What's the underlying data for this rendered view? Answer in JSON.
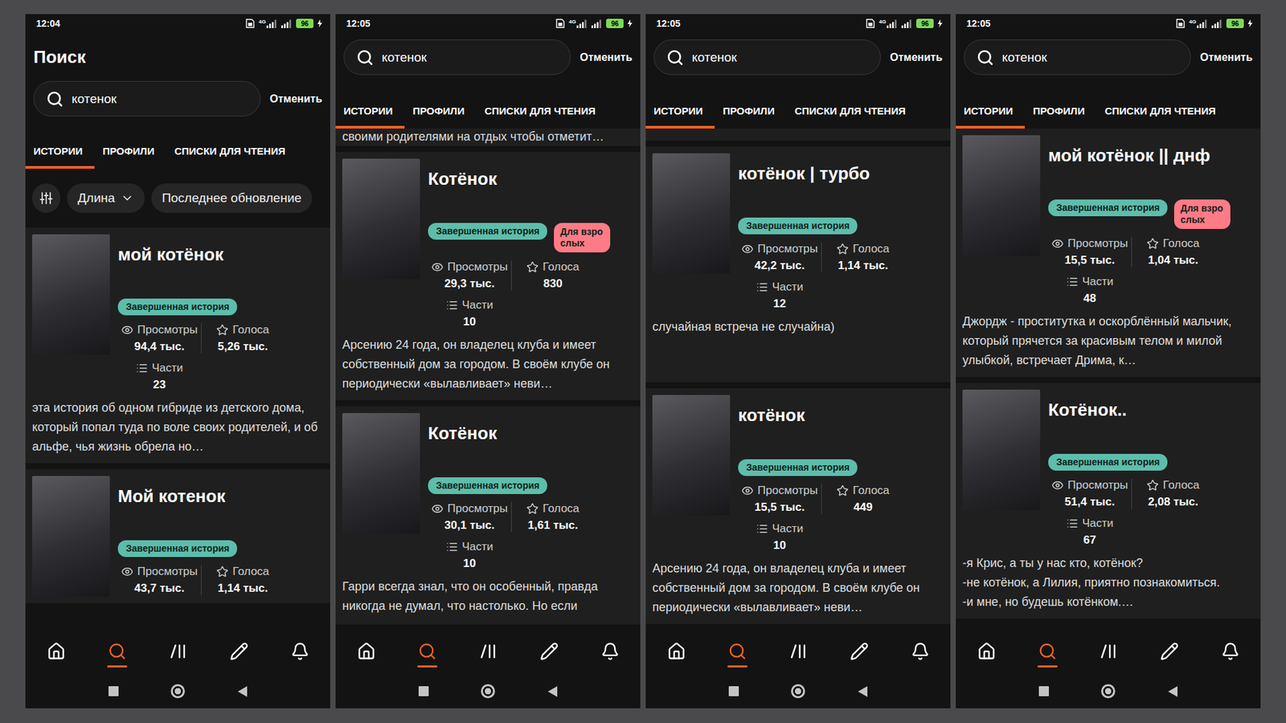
{
  "phones": [
    {
      "status_bar": {
        "time": "12:04",
        "network": "4G",
        "battery": "96"
      },
      "header_title": "Поиск",
      "search": {
        "value": "котенок",
        "cancel": "Отменить"
      },
      "tabs": [
        {
          "label": "ИСТОРИИ",
          "selected": true
        },
        {
          "label": "ПРОФИЛИ",
          "selected": false
        },
        {
          "label": "СПИСКИ ДЛЯ ЧТЕНИЯ",
          "selected": false
        }
      ],
      "filters": [
        {
          "kind": "icon"
        },
        {
          "kind": "dropdown",
          "label": "Длина"
        },
        {
          "kind": "chip",
          "label": "Последнее обновление"
        }
      ],
      "stories": [
        {
          "title": "мой котёнок",
          "badges": [
            {
              "label": "Завершенная история",
              "kind": "complete",
              "color": "#5dbdaa"
            }
          ],
          "stats": [
            {
              "kind": "views",
              "label": "Просмотры",
              "value": "94,4 тыс."
            },
            {
              "kind": "votes",
              "label": "Голоса",
              "value": "5,26 тыс."
            },
            {
              "kind": "parts",
              "label": "Части",
              "value": "23"
            }
          ],
          "description": "эта история об одном гибриде из детского дома, который попал туда по воле своих родителей, и об альфе, чья жизнь обрела но…"
        },
        {
          "title": "Мой котенок",
          "badges": [
            {
              "label": "Завершенная история",
              "kind": "complete",
              "color": "#5dbdaa"
            }
          ],
          "stats": [
            {
              "kind": "views",
              "label": "Просмотры",
              "value": "43,7 тыс."
            },
            {
              "kind": "votes",
              "label": "Голоса",
              "value": "1,14 тыс."
            }
          ]
        }
      ],
      "bottom_nav": [
        {
          "selected": false
        },
        {
          "selected": true
        },
        {
          "selected": false
        },
        {
          "selected": false
        },
        {
          "selected": false
        }
      ]
    },
    {
      "status_bar": {
        "time": "12:05",
        "network": "4G",
        "battery": "96"
      },
      "search": {
        "value": "котенок",
        "cancel": "Отменить"
      },
      "tabs": [
        {
          "label": "ИСТОРИИ",
          "selected": true
        },
        {
          "label": "ПРОФИЛИ",
          "selected": false
        },
        {
          "label": "СПИСКИ ДЛЯ ЧТЕНИЯ",
          "selected": false
        }
      ],
      "top_fragment": {
        "kind": "text",
        "text": "своими родителями на отдых чтобы отметит…"
      },
      "stories": [
        {
          "title": "Котёнок",
          "badges": [
            {
              "label": "Завершенная история",
              "kind": "complete",
              "color": "#5dbdaa"
            },
            {
              "label": "Для взрослых",
              "kind": "mature",
              "color": "#ff7b86"
            }
          ],
          "stats": [
            {
              "kind": "views",
              "label": "Просмотры",
              "value": "29,3 тыс."
            },
            {
              "kind": "votes",
              "label": "Голоса",
              "value": "830"
            },
            {
              "kind": "parts",
              "label": "Части",
              "value": "10"
            }
          ],
          "description": "Арсению 24 года, он владелец клуба и имеет собственный дом за городом. В своём клубе он периодически «вылавливает» неви…"
        },
        {
          "title": "Котёнок",
          "badges": [
            {
              "label": "Завершенная история",
              "kind": "complete",
              "color": "#5dbdaa"
            }
          ],
          "stats": [
            {
              "kind": "views",
              "label": "Просмотры",
              "value": "30,1 тыс."
            },
            {
              "kind": "votes",
              "label": "Голоса",
              "value": "1,61 тыс."
            },
            {
              "kind": "parts",
              "label": "Части",
              "value": "10"
            }
          ],
          "description": "Гарри всегда знал, что он особенный, правда никогда не думал, что настолько. Но если"
        }
      ],
      "bottom_nav": [
        {
          "selected": false
        },
        {
          "selected": true
        },
        {
          "selected": false
        },
        {
          "selected": false
        },
        {
          "selected": false
        }
      ]
    },
    {
      "status_bar": {
        "time": "12:05",
        "network": "4G",
        "battery": "96"
      },
      "search": {
        "value": "котенок",
        "cancel": "Отменить"
      },
      "tabs": [
        {
          "label": "ИСТОРИИ",
          "selected": true
        },
        {
          "label": "ПРОФИЛИ",
          "selected": false
        },
        {
          "label": "СПИСКИ ДЛЯ ЧТЕНИЯ",
          "selected": false
        }
      ],
      "top_fragment": {
        "kind": "blank"
      },
      "stories": [
        {
          "title": "котёнок | турбо",
          "badges": [
            {
              "label": "Завершенная история",
              "kind": "complete",
              "color": "#5dbdaa"
            }
          ],
          "stats": [
            {
              "kind": "views",
              "label": "Просмотры",
              "value": "42,2 тыс."
            },
            {
              "kind": "votes",
              "label": "Голоса",
              "value": "1,14 тыс."
            },
            {
              "kind": "parts",
              "label": "Части",
              "value": "12"
            }
          ],
          "description": "случайная встреча не случайна)"
        },
        {
          "title": "котёнок",
          "badges": [
            {
              "label": "Завершенная история",
              "kind": "complete",
              "color": "#5dbdaa"
            }
          ],
          "stats": [
            {
              "kind": "views",
              "label": "Просмотры",
              "value": "15,5 тыс."
            },
            {
              "kind": "votes",
              "label": "Голоса",
              "value": "449"
            },
            {
              "kind": "parts",
              "label": "Части",
              "value": "10"
            }
          ],
          "description": "Арсению 24 года, он владелец клуба и имеет собственный дом за городом. В своём клубе он периодически «вылавливает» неви…"
        }
      ],
      "bottom_nav": [
        {
          "selected": false
        },
        {
          "selected": true
        },
        {
          "selected": false
        },
        {
          "selected": false
        },
        {
          "selected": false
        }
      ]
    },
    {
      "status_bar": {
        "time": "12:05",
        "network": "4G",
        "battery": "96"
      },
      "search": {
        "value": "котенок",
        "cancel": "Отменить"
      },
      "tabs": [
        {
          "label": "ИСТОРИИ",
          "selected": true
        },
        {
          "label": "ПРОФИЛИ",
          "selected": false
        },
        {
          "label": "СПИСКИ ДЛЯ ЧТЕНИЯ",
          "selected": false
        }
      ],
      "stories": [
        {
          "title": "мой котёнок || днф",
          "badges": [
            {
              "label": "Завершенная история",
              "kind": "complete",
              "color": "#5dbdaa"
            },
            {
              "label": "Для взрослых",
              "kind": "mature",
              "color": "#ff7b86"
            }
          ],
          "stats": [
            {
              "kind": "views",
              "label": "Просмотры",
              "value": "15,5 тыс."
            },
            {
              "kind": "votes",
              "label": "Голоса",
              "value": "1,04 тыс."
            },
            {
              "kind": "parts",
              "label": "Части",
              "value": "48"
            }
          ],
          "description": "Джордж - проститутка и оскорблённый мальчик, который прячется за красивым телом и милой улыбкой, встречает Дрима, к…"
        },
        {
          "title": "Котёнок..",
          "badges": [
            {
              "label": "Завершенная история",
              "kind": "complete",
              "color": "#5dbdaa"
            }
          ],
          "stats": [
            {
              "kind": "views",
              "label": "Просмотры",
              "value": "51,4 тыс."
            },
            {
              "kind": "votes",
              "label": "Голоса",
              "value": "2,08 тыс."
            },
            {
              "kind": "parts",
              "label": "Части",
              "value": "67"
            }
          ],
          "description": "-я Крис, а ты у нас кто, котёнок?\n-не котёнок, а Лилия, приятно познакомиться.\n-и мне, но будешь котёнком.…"
        }
      ],
      "bottom_nav": [
        {
          "selected": false
        },
        {
          "selected": true
        },
        {
          "selected": false
        },
        {
          "selected": false
        },
        {
          "selected": false
        }
      ]
    }
  ]
}
